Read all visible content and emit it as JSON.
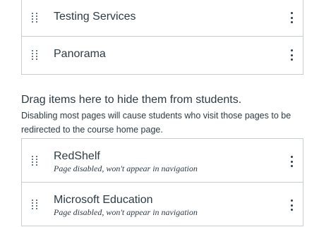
{
  "enabled_items": [
    {
      "label": "Testing Services"
    },
    {
      "label": "Panorama"
    }
  ],
  "hidden_section": {
    "heading": "Drag items here to hide them from students.",
    "description": "Disabling most pages will cause students who visit those pages to be redirected to the course home page."
  },
  "disabled_items": [
    {
      "label": "RedShelf",
      "status": "Page disabled, won't appear in navigation"
    },
    {
      "label": "Microsoft Education",
      "status": "Page disabled, won't appear in navigation"
    }
  ],
  "icons": {
    "drag": "drag-handle-icon",
    "menu": "kebab-menu-icon"
  }
}
